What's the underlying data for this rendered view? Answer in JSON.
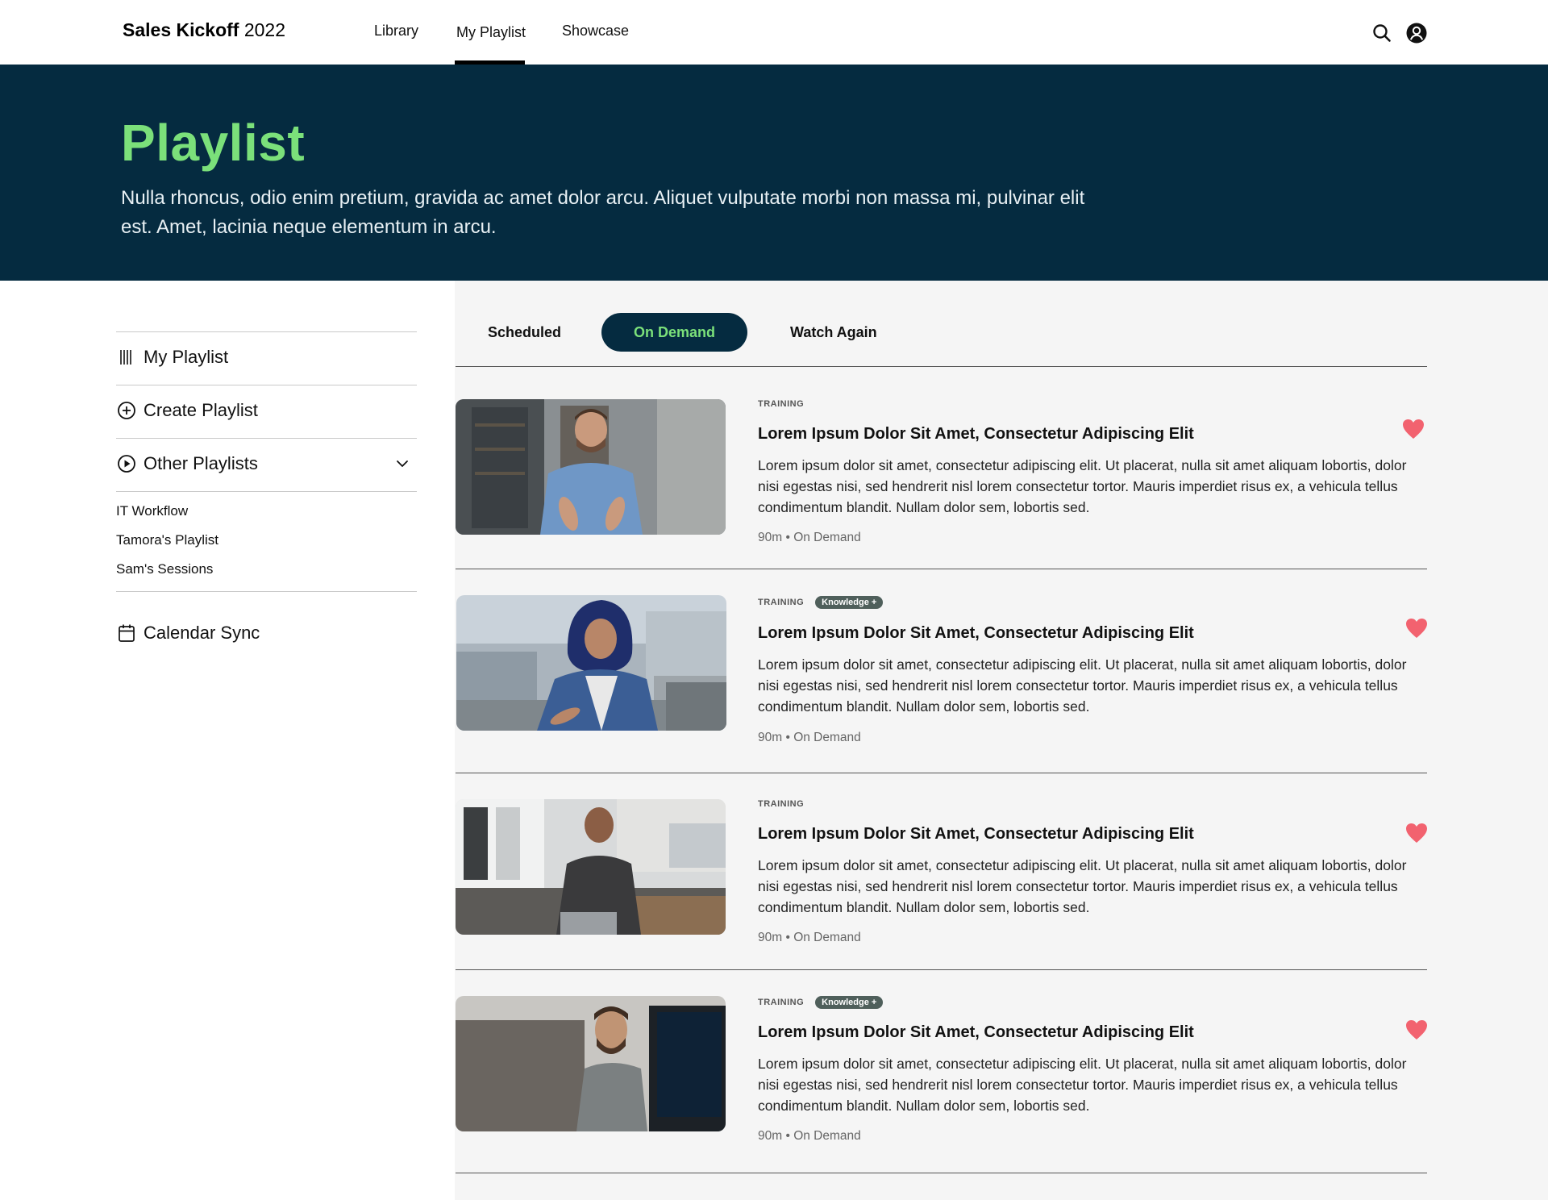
{
  "header": {
    "brand_bold": "Sales Kickoff",
    "brand_year": "2022",
    "nav": [
      "Library",
      "My Playlist",
      "Showcase"
    ],
    "active_nav": "My Playlist",
    "icons": [
      "search-icon",
      "user-account-icon"
    ]
  },
  "hero": {
    "title": "Playlist",
    "description": "Nulla rhoncus, odio enim pretium, gravida ac amet dolor arcu. Aliquet vulputate morbi non massa mi, pulvinar elit est. Amet, lacinia neque elementum in arcu."
  },
  "sidebar": {
    "items": [
      {
        "label": "My Playlist",
        "icon": "library-icon"
      },
      {
        "label": "Create Playlist",
        "icon": "plus-circle-icon"
      },
      {
        "label": "Other Playlists",
        "icon": "play-circle-icon",
        "expanded": true
      }
    ],
    "other_playlists": [
      "IT Workflow",
      "Tamora's Playlist",
      "Sam's Sessions"
    ],
    "calendar": {
      "label": "Calendar Sync",
      "icon": "calendar-icon"
    }
  },
  "tabs": [
    "Scheduled",
    "On Demand",
    "Watch Again"
  ],
  "active_tab": "On Demand",
  "cards": [
    {
      "category": "TRAINING",
      "badge": "",
      "title": "Lorem Ipsum Dolor Sit Amet, Consectetur Adipiscing Elit",
      "description": "Lorem ipsum dolor sit amet, consectetur adipiscing elit. Ut placerat, nulla sit amet aliquam lobortis, dolor nisi egestas nisi, sed hendrerit nisl lorem consectetur tortor. Mauris imperdiet risus ex, a vehicula tellus condimentum blandit. Nullam dolor sem, lobortis sed.",
      "info": "90m • On Demand",
      "favorite": true
    },
    {
      "category": "TRAINING",
      "badge": "Knowledge +",
      "title": "Lorem Ipsum Dolor Sit Amet, Consectetur Adipiscing Elit",
      "description": "Lorem ipsum dolor sit amet, consectetur adipiscing elit. Ut placerat, nulla sit amet aliquam lobortis, dolor nisi egestas nisi, sed hendrerit nisl lorem consectetur tortor. Mauris imperdiet risus ex, a vehicula tellus condimentum blandit. Nullam dolor sem, lobortis sed.",
      "info": "90m • On Demand",
      "favorite": true
    },
    {
      "category": "TRAINING",
      "badge": "",
      "title": "Lorem Ipsum Dolor Sit Amet, Consectetur Adipiscing Elit",
      "description": "Lorem ipsum dolor sit amet, consectetur adipiscing elit. Ut placerat, nulla sit amet aliquam lobortis, dolor nisi egestas nisi, sed hendrerit nisl lorem consectetur tortor. Mauris imperdiet risus ex, a vehicula tellus condimentum blandit. Nullam dolor sem, lobortis sed.",
      "info": "90m • On Demand",
      "favorite": true
    },
    {
      "category": "TRAINING",
      "badge": "Knowledge +",
      "title": "Lorem Ipsum Dolor Sit Amet, Consectetur Adipiscing Elit",
      "description": "Lorem ipsum dolor sit amet, consectetur adipiscing elit. Ut placerat, nulla sit amet aliquam lobortis, dolor nisi egestas nisi, sed hendrerit nisl lorem consectetur tortor. Mauris imperdiet risus ex, a vehicula tellus condimentum blandit. Nullam dolor sem, lobortis sed.",
      "info": "90m • On Demand",
      "favorite": true
    }
  ],
  "colors": {
    "hero_bg": "#052b40",
    "accent_green": "#7be07a",
    "heart": "#f2626f",
    "badge_bg": "#4f5f5b",
    "panel_bg": "#f5f5f5"
  }
}
